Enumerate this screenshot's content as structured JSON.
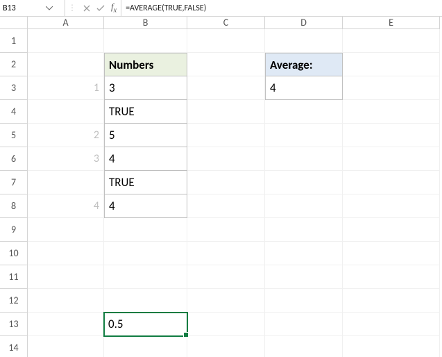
{
  "namebox": {
    "value": "B13"
  },
  "formula": {
    "text": "=AVERAGE(TRUE,FALSE)"
  },
  "columns": [
    "A",
    "B",
    "C",
    "D",
    "E"
  ],
  "row_headers": [
    "1",
    "2",
    "3",
    "4",
    "5",
    "6",
    "7",
    "8",
    "9",
    "10",
    "11",
    "12",
    "13",
    "14"
  ],
  "colA": {
    "r3": "1",
    "r5": "2",
    "r6": "3",
    "r8": "4"
  },
  "colB": {
    "header": "Numbers",
    "r3": "3",
    "r4": "TRUE",
    "r5": "5",
    "r6": "4",
    "r7": "TRUE",
    "r8": "4",
    "r13": "0.5"
  },
  "colD": {
    "header": "Average:",
    "r3": "4"
  },
  "selected_cell": "B13",
  "chart_data": {
    "type": "table",
    "tables": [
      {
        "title": "Numbers",
        "headers": [
          "Numbers"
        ],
        "rows": [
          [
            "3"
          ],
          [
            "TRUE"
          ],
          [
            "5"
          ],
          [
            "4"
          ],
          [
            "TRUE"
          ],
          [
            "4"
          ]
        ]
      },
      {
        "title": "Average",
        "headers": [
          "Average:"
        ],
        "rows": [
          [
            "4"
          ]
        ]
      }
    ],
    "formula_result": {
      "cell": "B13",
      "formula": "=AVERAGE(TRUE,FALSE)",
      "value": 0.5
    }
  }
}
